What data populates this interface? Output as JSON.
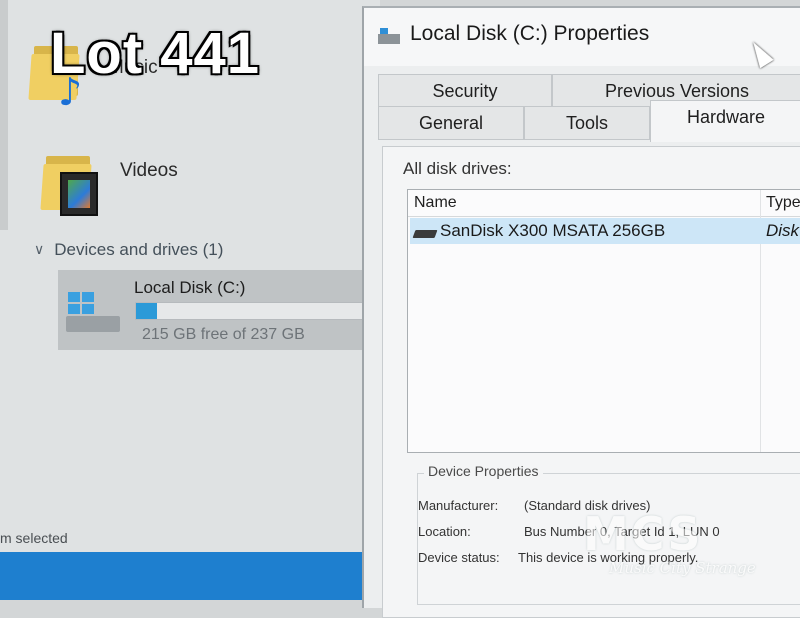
{
  "overlay": {
    "lot_label": "Lot 441"
  },
  "explorer": {
    "folders": [
      {
        "label": "Music",
        "icon": "music-folder-icon"
      },
      {
        "label": "Videos",
        "icon": "videos-folder-icon"
      }
    ],
    "devices_section": {
      "label": "Devices and drives (1)",
      "icon": "chevron-down-icon"
    },
    "drive": {
      "name": "Local Disk (C:)",
      "free_text": "215 GB free of 237 GB",
      "used_fraction": 0.093,
      "icon": "local-disk-icon",
      "bar_color": "#2b9ad8"
    },
    "status_text": "m selected",
    "taskbar_color": "#1e7fcf"
  },
  "dialog": {
    "title": "Local Disk (C:) Properties",
    "tabs_row1": [
      "Security",
      "Previous Versions"
    ],
    "tabs_row2": [
      "General",
      "Tools",
      "Hardware"
    ],
    "active_tab": "Hardware",
    "list_label": "All disk drives:",
    "columns": [
      "Name",
      "Type"
    ],
    "rows": [
      {
        "name": "SanDisk X300 MSATA 256GB",
        "type": "Disk d"
      }
    ],
    "device_properties": {
      "title": "Device Properties",
      "manufacturer_label": "Manufacturer:",
      "manufacturer_value": "(Standard disk drives)",
      "location_label": "Location:",
      "location_value": "Bus Number 0, Target Id 1, LUN 0",
      "status_label": "Device status:",
      "status_value": "This device is working properly."
    }
  },
  "watermark": {
    "big": "MCS",
    "small": "Music City Strange"
  }
}
